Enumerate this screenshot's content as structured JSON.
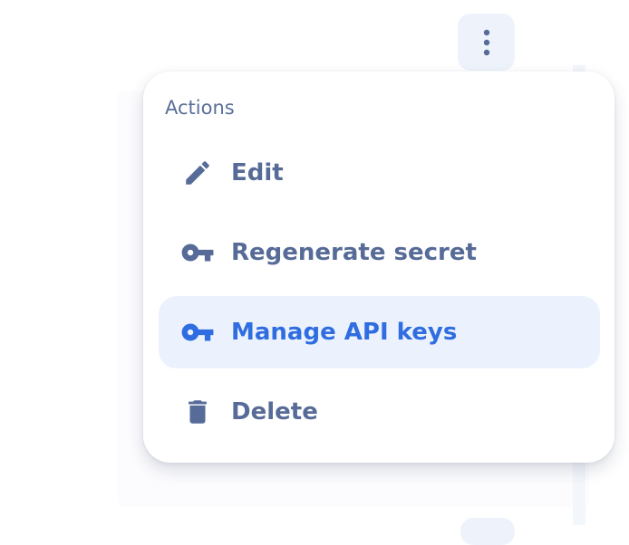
{
  "menu": {
    "header": "Actions",
    "items": [
      {
        "label": "Edit",
        "icon": "pencil-icon"
      },
      {
        "label": "Regenerate secret",
        "icon": "key-icon"
      },
      {
        "label": "Manage API keys",
        "icon": "key-icon",
        "active": true
      },
      {
        "label": "Delete",
        "icon": "trash-icon"
      }
    ]
  },
  "kebab_button": {
    "icon": "more-vertical-icon"
  },
  "colors": {
    "text": "#566b97",
    "accent": "#2f6de0",
    "active_background": "#ebf2fd",
    "button_background": "#eef3fb"
  }
}
